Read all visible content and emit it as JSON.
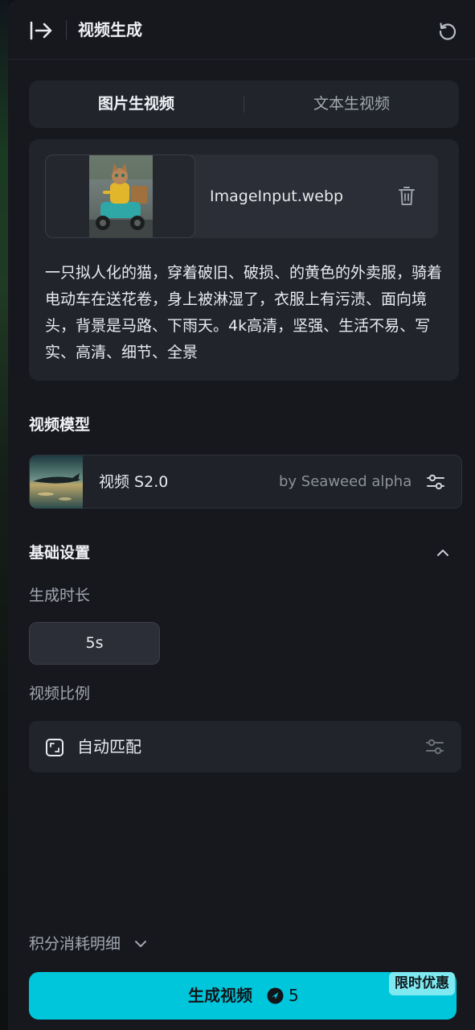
{
  "header": {
    "title": "视频生成",
    "collapse_icon": "collapse-right-icon",
    "refresh_icon": "refresh-icon"
  },
  "tabs": [
    {
      "label": "图片生视频",
      "active": true
    },
    {
      "label": "文本生视频",
      "active": false
    }
  ],
  "upload": {
    "file_name": "ImageInput.webp",
    "delete_icon": "trash-icon"
  },
  "prompt": {
    "text": "一只拟人化的猫，穿着破旧、破损、的黄色的外卖服，骑着电动车在送花卷，身上被淋湿了，衣服上有污渍、面向境头，背景是马路、下雨天。4k高清，坚强、生活不易、写实、高清、细节、全景"
  },
  "model_section": {
    "title": "视频模型",
    "model_name": "视频 S2.0",
    "model_by": "by Seaweed alpha",
    "settings_icon": "sliders-icon"
  },
  "basic_settings": {
    "title": "基础设置",
    "collapse_icon": "chevron-up-icon",
    "duration_label": "生成时长",
    "duration_value": "5s",
    "ratio_label": "视频比例",
    "ratio_value": "自动匹配",
    "ratio_icon": "aspect-ratio-icon"
  },
  "cost": {
    "label": "积分消耗明细",
    "icon": "chevron-down-icon"
  },
  "generate": {
    "label": "生成视频",
    "credits": "5",
    "credit_icon": "credit-star-icon",
    "badge": "限时优惠"
  },
  "colors": {
    "accent": "#00c6dc",
    "panel_bg": "#16181e",
    "card_bg": "#21242b"
  }
}
